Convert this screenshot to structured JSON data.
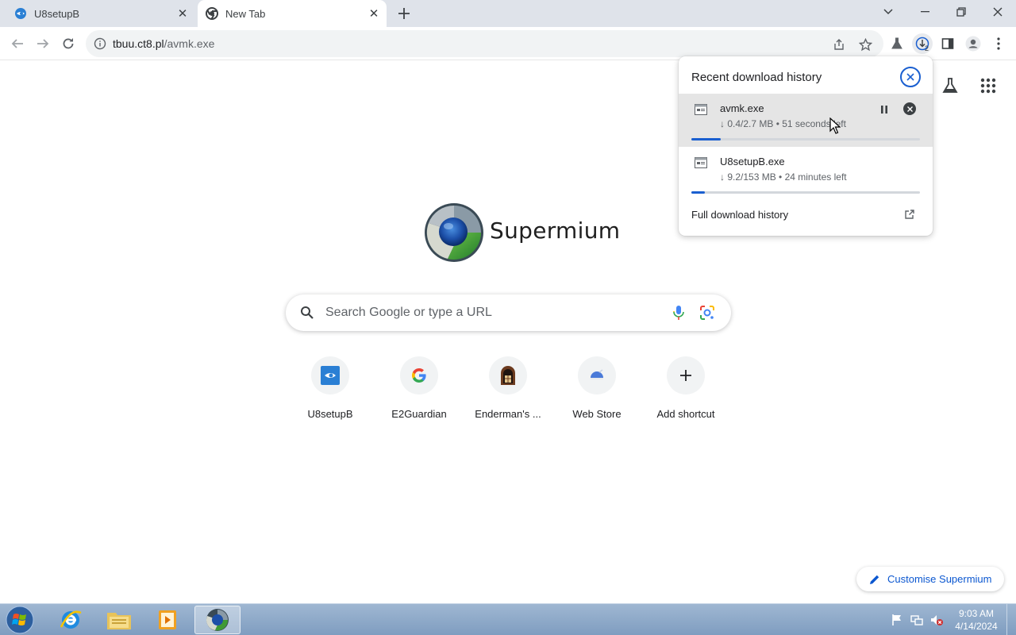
{
  "tabs": [
    {
      "title": "U8setupB",
      "active": false
    },
    {
      "title": "New Tab",
      "active": true
    }
  ],
  "address_bar": {
    "host": "tbuu.ct8.pl",
    "path": "/avmk.exe"
  },
  "toolbar": {
    "download_count": "2"
  },
  "brand": {
    "name": "Supermium"
  },
  "search": {
    "placeholder": "Search Google or type a URL"
  },
  "shortcuts": [
    {
      "label": "U8setupB",
      "icon": "u8-icon"
    },
    {
      "label": "E2Guardian",
      "icon": "google-g-icon"
    },
    {
      "label": "Enderman's ...",
      "icon": "enderman-icon"
    },
    {
      "label": "Web Store",
      "icon": "web-store-icon"
    },
    {
      "label": "Add shortcut",
      "icon": "plus-icon"
    }
  ],
  "customise": {
    "label": "Customise Supermium"
  },
  "downloads": {
    "title": "Recent download history",
    "items": [
      {
        "name": "avmk.exe",
        "status": "↓ 0.4/2.7 MB • 51 seconds left",
        "progress": 0.13
      },
      {
        "name": "U8setupB.exe",
        "status": "↓ 9.2/153 MB • 24 minutes left",
        "progress": 0.06
      }
    ],
    "full_history_label": "Full download history"
  },
  "taskbar": {
    "time": "9:03 AM",
    "date": "4/14/2024"
  },
  "colors": {
    "accent": "#1a5fd0",
    "tabstrip": "#dfe3ea",
    "taskbar": "#8eaac9"
  }
}
